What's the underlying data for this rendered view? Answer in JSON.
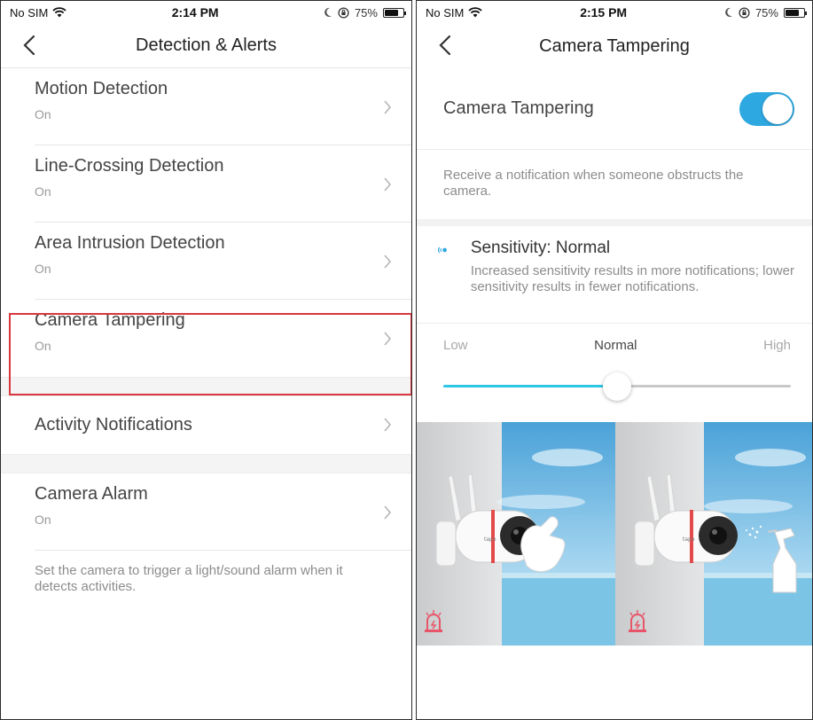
{
  "left": {
    "status": {
      "carrier": "No SIM",
      "time": "2:14 PM",
      "battery": "75%"
    },
    "nav": {
      "title": "Detection & Alerts"
    },
    "items": [
      {
        "title": "Motion Detection",
        "value": "On"
      },
      {
        "title": "Line-Crossing Detection",
        "value": "On"
      },
      {
        "title": "Area Intrusion Detection",
        "value": "On"
      },
      {
        "title": "Camera Tampering",
        "value": "On"
      }
    ],
    "activity": {
      "title": "Activity Notifications"
    },
    "alarm": {
      "title": "Camera Alarm",
      "value": "On"
    },
    "footnote": "Set the camera to trigger a light/sound alarm when it detects activities."
  },
  "right": {
    "status": {
      "carrier": "No SIM",
      "time": "2:15 PM",
      "battery": "75%"
    },
    "nav": {
      "title": "Camera Tampering"
    },
    "toggle": {
      "label": "Camera Tampering",
      "on": true
    },
    "description": "Receive a notification when someone obstructs the camera.",
    "sensitivity": {
      "title": "Sensitivity: Normal",
      "description": "Increased sensitivity results in more notifications; lower sensitivity results in fewer notifications."
    },
    "levels": {
      "low": "Low",
      "normal": "Normal",
      "high": "High"
    },
    "slider": {
      "value": 0.5
    },
    "illustrations": [
      {
        "name": "camera-blocked-by-hand"
      },
      {
        "name": "camera-sprayed"
      }
    ],
    "camera_brand": "tapo"
  },
  "colors": {
    "accent": "#2ea8e0",
    "slider": "#2ec7e6",
    "highlight": "#d9363e",
    "alarm_icon": "#e8556a"
  },
  "icons": [
    "wifi-icon",
    "moon-icon",
    "orientation-lock-icon",
    "battery-icon",
    "back-arrow-icon",
    "chevron-right-icon",
    "sensitivity-icon",
    "alarm-light-icon"
  ]
}
